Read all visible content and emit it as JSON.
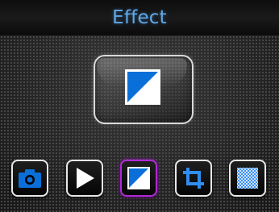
{
  "header": {
    "title": "Effect"
  },
  "preview": {
    "icon": "effect-icon"
  },
  "toolbar": {
    "items": [
      {
        "icon": "camera-icon",
        "selected": false
      },
      {
        "icon": "play-icon",
        "selected": false
      },
      {
        "icon": "effect-icon",
        "selected": true
      },
      {
        "icon": "crop-icon",
        "selected": false
      },
      {
        "icon": "mosaic-icon",
        "selected": false
      }
    ]
  },
  "colors": {
    "title": "#5fa8e8",
    "accent_blue": "#0a6fd8",
    "selected_border": "#b02ad6",
    "button_border": "#e8e8e8"
  }
}
